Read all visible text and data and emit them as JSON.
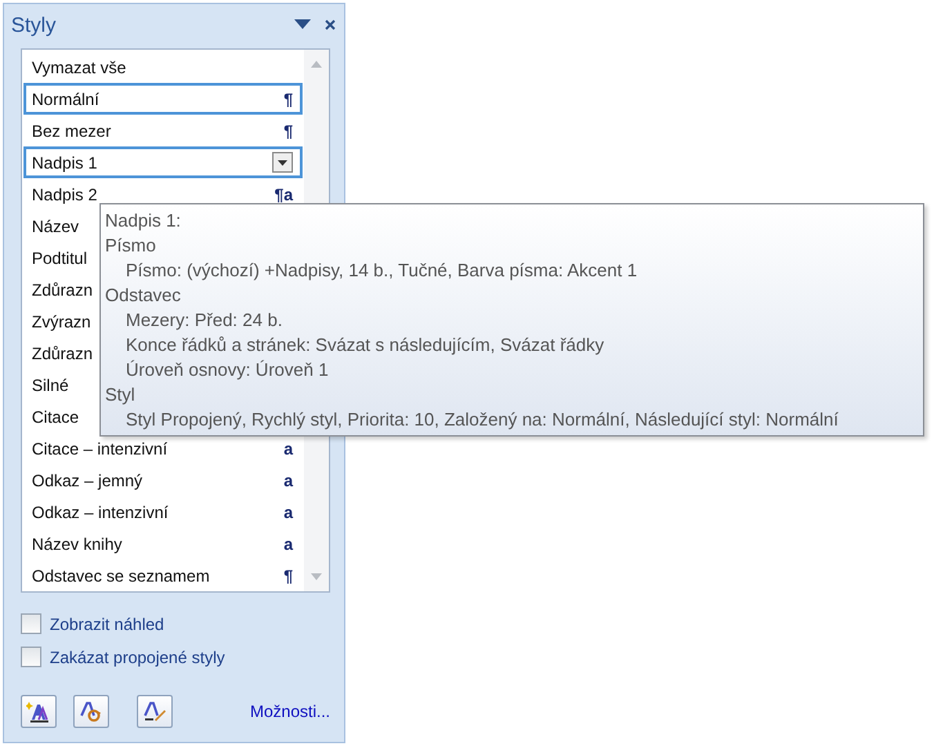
{
  "pane": {
    "title": "Styly"
  },
  "styles": [
    {
      "label": "Vymazat vše",
      "selected": false
    },
    {
      "label": "Normální",
      "selected": true,
      "mark": "¶"
    },
    {
      "label": "Bez mezer",
      "selected": false,
      "mark": "¶"
    },
    {
      "label": "Nadpis 1",
      "selected": true,
      "dropdown": true
    },
    {
      "label": "Nadpis 2",
      "selected": false,
      "mark": "¶a"
    },
    {
      "label": "Název",
      "selected": false
    },
    {
      "label": "Podtitul",
      "selected": false
    },
    {
      "label": "Zdůrazn",
      "selected": false
    },
    {
      "label": "Zvýrazn",
      "selected": false
    },
    {
      "label": "Zdůrazn",
      "selected": false
    },
    {
      "label": "Silné",
      "selected": false
    },
    {
      "label": "Citace",
      "selected": false
    },
    {
      "label": "Citace – intenzivní",
      "selected": false,
      "mark": "a"
    },
    {
      "label": "Odkaz – jemný",
      "selected": false,
      "mark": "a"
    },
    {
      "label": "Odkaz – intenzivní",
      "selected": false,
      "mark": "a"
    },
    {
      "label": "Název knihy",
      "selected": false,
      "mark": "a"
    },
    {
      "label": "Odstavec se seznamem",
      "selected": false,
      "mark": "¶"
    }
  ],
  "tooltip": {
    "title": "Nadpis 1:",
    "sections": [
      {
        "heading": "Písmo",
        "lines": [
          "Písmo:  (výchozí) +Nadpisy, 14 b., Tučné, Barva písma: Akcent 1"
        ]
      },
      {
        "heading": "Odstavec",
        "lines": [
          "Mezery:  Před:  24 b.",
          "Konce řádků a stránek:  Svázat s následujícím, Svázat řádky",
          "Úroveň osnovy:  Úroveň 1"
        ]
      },
      {
        "heading": "Styl",
        "lines": [
          "Styl Propojený, Rychlý styl, Priorita: 10, Založený na: Normální, Následující styl: Normální"
        ]
      }
    ]
  },
  "options": [
    {
      "label": "Zobrazit náhled",
      "checked": false
    },
    {
      "label": "Zakázat propojené styly",
      "checked": false
    }
  ],
  "link": "Možnosti..."
}
